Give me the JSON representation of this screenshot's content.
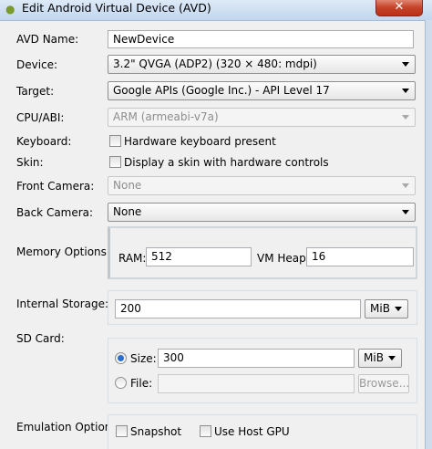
{
  "window": {
    "title": "Edit Android Virtual Device (AVD)",
    "close_glyph": "✕"
  },
  "avd_name": {
    "label": "AVD Name:",
    "value": "NewDevice"
  },
  "device": {
    "label": "Device:",
    "value": "3.2\" QVGA (ADP2) (320 × 480: mdpi)"
  },
  "target": {
    "label": "Target:",
    "value": "Google APIs (Google Inc.) - API Level 17"
  },
  "cpu_abi": {
    "label": "CPU/ABI:",
    "value": "ARM (armeabi-v7a)"
  },
  "keyboard": {
    "label": "Keyboard:",
    "checkbox_label": "Hardware keyboard present",
    "checked": false
  },
  "skin": {
    "label": "Skin:",
    "checkbox_label": "Display a skin with hardware controls",
    "checked": false
  },
  "front_camera": {
    "label": "Front Camera:",
    "value": "None"
  },
  "back_camera": {
    "label": "Back Camera:",
    "value": "None"
  },
  "memory": {
    "label": "Memory Options:",
    "ram_label": "RAM:",
    "ram_value": "512",
    "vm_heap_label": "VM Heap:",
    "vm_heap_value": "16"
  },
  "internal_storage": {
    "label": "Internal Storage:",
    "value": "200",
    "unit": "MiB"
  },
  "sd_card": {
    "label": "SD Card:",
    "size_label": "Size:",
    "size_value": "300",
    "size_unit": "MiB",
    "file_label": "File:",
    "file_value": "",
    "browse_label": "Browse..."
  },
  "emulation": {
    "label": "Emulation Options:",
    "snapshot_label": "Snapshot",
    "host_gpu_label": "Use Host GPU"
  },
  "colors": {
    "title_bar": "#c3d6ee",
    "close_button": "#c7432a",
    "dialog_bg": "#f0f0f0",
    "radio_selected": "#2a6fd0"
  }
}
